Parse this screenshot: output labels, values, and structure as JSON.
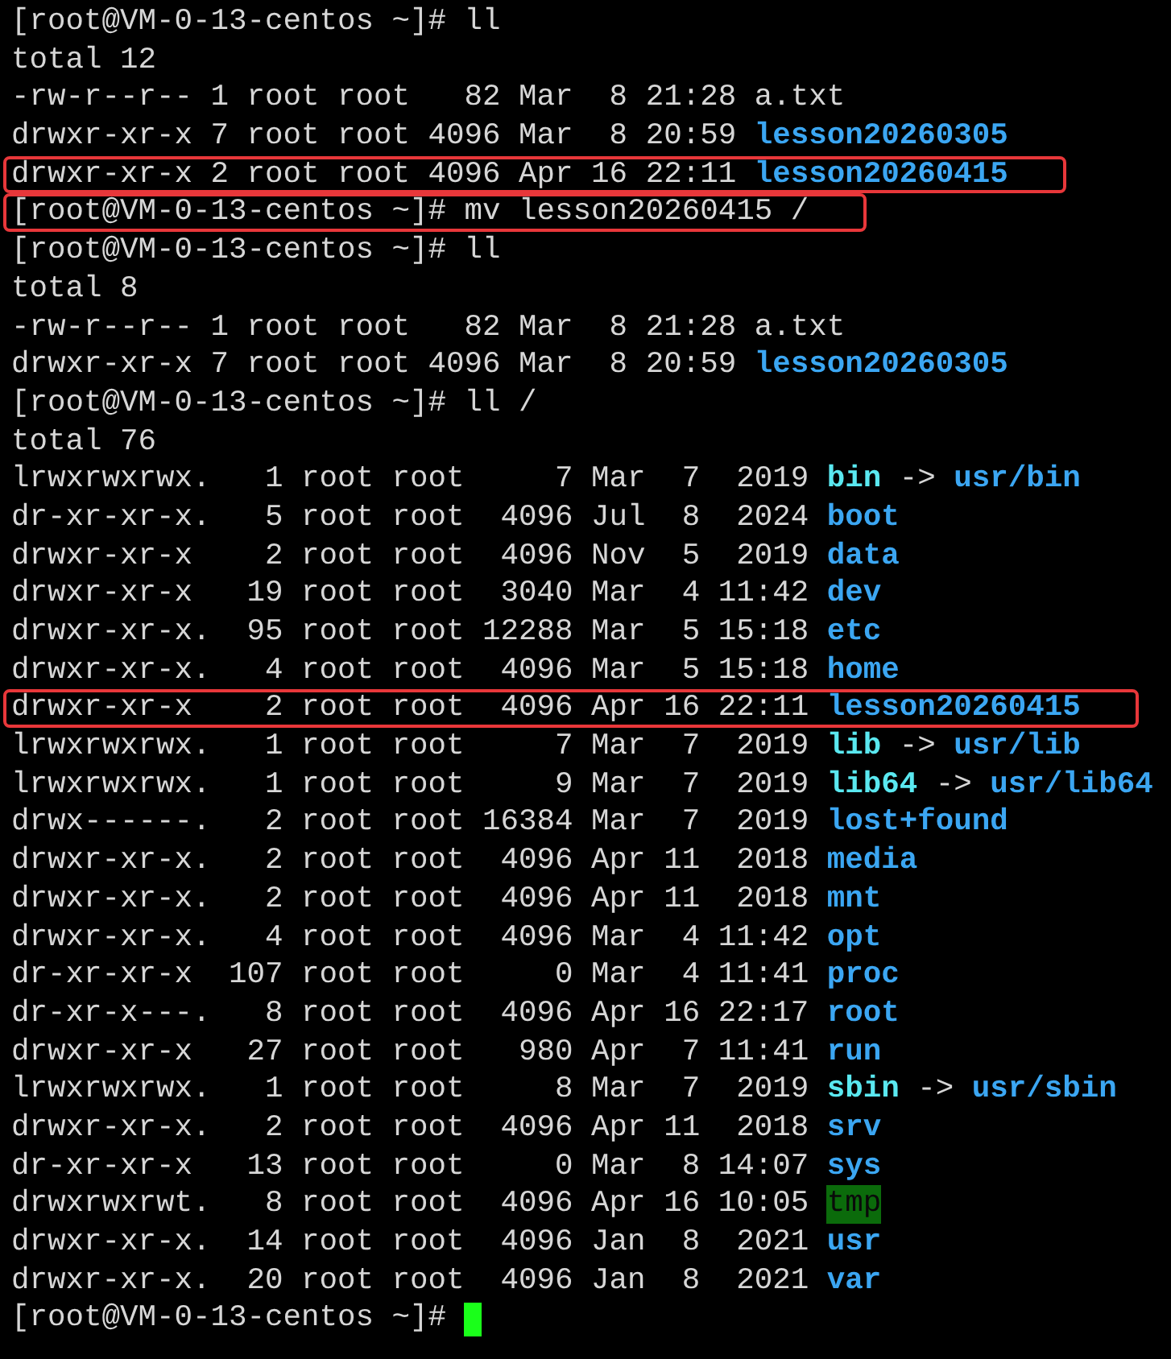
{
  "terminal": {
    "lines": [
      {
        "segments": [
          {
            "kind": "plain",
            "text": "[root@VM-0-13-centos ~]# ll"
          }
        ]
      },
      {
        "segments": [
          {
            "kind": "plain",
            "text": "total 12"
          }
        ]
      },
      {
        "segments": [
          {
            "kind": "plain",
            "text": "-rw-r--r-- 1 root root   82 Mar  8 21:28 a.txt"
          }
        ]
      },
      {
        "segments": [
          {
            "kind": "plain",
            "text": "drwxr-xr-x 7 root root 4096 Mar  8 20:59 "
          },
          {
            "kind": "dir",
            "text": "lesson20260305"
          }
        ]
      },
      {
        "boxed": true,
        "segments": [
          {
            "kind": "plain",
            "text": "drwxr-xr-x 2 root root 4096 Apr 16 22:11 "
          },
          {
            "kind": "dir",
            "text": "lesson20260415"
          }
        ]
      },
      {
        "boxed": true,
        "segments": [
          {
            "kind": "plain",
            "text": "[root@VM-0-13-centos ~]# mv lesson20260415 /"
          }
        ]
      },
      {
        "segments": [
          {
            "kind": "plain",
            "text": "[root@VM-0-13-centos ~]# ll"
          }
        ]
      },
      {
        "segments": [
          {
            "kind": "plain",
            "text": "total 8"
          }
        ]
      },
      {
        "segments": [
          {
            "kind": "plain",
            "text": "-rw-r--r-- 1 root root   82 Mar  8 21:28 a.txt"
          }
        ]
      },
      {
        "segments": [
          {
            "kind": "plain",
            "text": "drwxr-xr-x 7 root root 4096 Mar  8 20:59 "
          },
          {
            "kind": "dir",
            "text": "lesson20260305"
          }
        ]
      },
      {
        "segments": [
          {
            "kind": "plain",
            "text": "[root@VM-0-13-centos ~]# ll /"
          }
        ]
      },
      {
        "segments": [
          {
            "kind": "plain",
            "text": "total 76"
          }
        ]
      },
      {
        "segments": [
          {
            "kind": "plain",
            "text": "lrwxrwxrwx.   1 root root     7 Mar  7  2019 "
          },
          {
            "kind": "link",
            "text": "bin"
          },
          {
            "kind": "plain",
            "text": " -> "
          },
          {
            "kind": "dir",
            "text": "usr/bin"
          }
        ]
      },
      {
        "segments": [
          {
            "kind": "plain",
            "text": "dr-xr-xr-x.   5 root root  4096 Jul  8  2024 "
          },
          {
            "kind": "dir",
            "text": "boot"
          }
        ]
      },
      {
        "segments": [
          {
            "kind": "plain",
            "text": "drwxr-xr-x    2 root root  4096 Nov  5  2019 "
          },
          {
            "kind": "dir",
            "text": "data"
          }
        ]
      },
      {
        "segments": [
          {
            "kind": "plain",
            "text": "drwxr-xr-x   19 root root  3040 Mar  4 11:42 "
          },
          {
            "kind": "dir",
            "text": "dev"
          }
        ]
      },
      {
        "segments": [
          {
            "kind": "plain",
            "text": "drwxr-xr-x.  95 root root 12288 Mar  5 15:18 "
          },
          {
            "kind": "dir",
            "text": "etc"
          }
        ]
      },
      {
        "segments": [
          {
            "kind": "plain",
            "text": "drwxr-xr-x.   4 root root  4096 Mar  5 15:18 "
          },
          {
            "kind": "dir",
            "text": "home"
          }
        ]
      },
      {
        "boxed": true,
        "segments": [
          {
            "kind": "plain",
            "text": "drwxr-xr-x    2 root root  4096 Apr 16 22:11 "
          },
          {
            "kind": "dir",
            "text": "lesson20260415"
          }
        ]
      },
      {
        "segments": [
          {
            "kind": "plain",
            "text": "lrwxrwxrwx.   1 root root     7 Mar  7  2019 "
          },
          {
            "kind": "link",
            "text": "lib"
          },
          {
            "kind": "plain",
            "text": " -> "
          },
          {
            "kind": "dir",
            "text": "usr/lib"
          }
        ]
      },
      {
        "segments": [
          {
            "kind": "plain",
            "text": "lrwxrwxrwx.   1 root root     9 Mar  7  2019 "
          },
          {
            "kind": "link",
            "text": "lib64"
          },
          {
            "kind": "plain",
            "text": " -> "
          },
          {
            "kind": "dir",
            "text": "usr/lib64"
          }
        ]
      },
      {
        "segments": [
          {
            "kind": "plain",
            "text": "drwx------.   2 root root 16384 Mar  7  2019 "
          },
          {
            "kind": "dir",
            "text": "lost+found"
          }
        ]
      },
      {
        "segments": [
          {
            "kind": "plain",
            "text": "drwxr-xr-x.   2 root root  4096 Apr 11  2018 "
          },
          {
            "kind": "dir",
            "text": "media"
          }
        ]
      },
      {
        "segments": [
          {
            "kind": "plain",
            "text": "drwxr-xr-x.   2 root root  4096 Apr 11  2018 "
          },
          {
            "kind": "dir",
            "text": "mnt"
          }
        ]
      },
      {
        "segments": [
          {
            "kind": "plain",
            "text": "drwxr-xr-x.   4 root root  4096 Mar  4 11:42 "
          },
          {
            "kind": "dir",
            "text": "opt"
          }
        ]
      },
      {
        "segments": [
          {
            "kind": "plain",
            "text": "dr-xr-xr-x  107 root root     0 Mar  4 11:41 "
          },
          {
            "kind": "dir",
            "text": "proc"
          }
        ]
      },
      {
        "segments": [
          {
            "kind": "plain",
            "text": "dr-xr-x---.   8 root root  4096 Apr 16 22:17 "
          },
          {
            "kind": "dir",
            "text": "root"
          }
        ]
      },
      {
        "segments": [
          {
            "kind": "plain",
            "text": "drwxr-xr-x   27 root root   980 Apr  7 11:41 "
          },
          {
            "kind": "dir",
            "text": "run"
          }
        ]
      },
      {
        "segments": [
          {
            "kind": "plain",
            "text": "lrwxrwxrwx.   1 root root     8 Mar  7  2019 "
          },
          {
            "kind": "link",
            "text": "sbin"
          },
          {
            "kind": "plain",
            "text": " -> "
          },
          {
            "kind": "dir",
            "text": "usr/sbin"
          }
        ]
      },
      {
        "segments": [
          {
            "kind": "plain",
            "text": "drwxr-xr-x.   2 root root  4096 Apr 11  2018 "
          },
          {
            "kind": "dir",
            "text": "srv"
          }
        ]
      },
      {
        "segments": [
          {
            "kind": "plain",
            "text": "dr-xr-xr-x   13 root root     0 Mar  8 14:07 "
          },
          {
            "kind": "dir",
            "text": "sys"
          }
        ]
      },
      {
        "segments": [
          {
            "kind": "plain",
            "text": "drwxrwxrwt.   8 root root  4096 Apr 16 10:05 "
          },
          {
            "kind": "sticky",
            "text": "tmp"
          }
        ]
      },
      {
        "segments": [
          {
            "kind": "plain",
            "text": "drwxr-xr-x.  14 root root  4096 Jan  8  2021 "
          },
          {
            "kind": "dir",
            "text": "usr"
          }
        ]
      },
      {
        "segments": [
          {
            "kind": "plain",
            "text": "drwxr-xr-x.  20 root root  4096 Jan  8  2021 "
          },
          {
            "kind": "dir",
            "text": "var"
          }
        ]
      },
      {
        "cursor": true,
        "segments": [
          {
            "kind": "plain",
            "text": "[root@VM-0-13-centos ~]# "
          }
        ]
      }
    ]
  }
}
